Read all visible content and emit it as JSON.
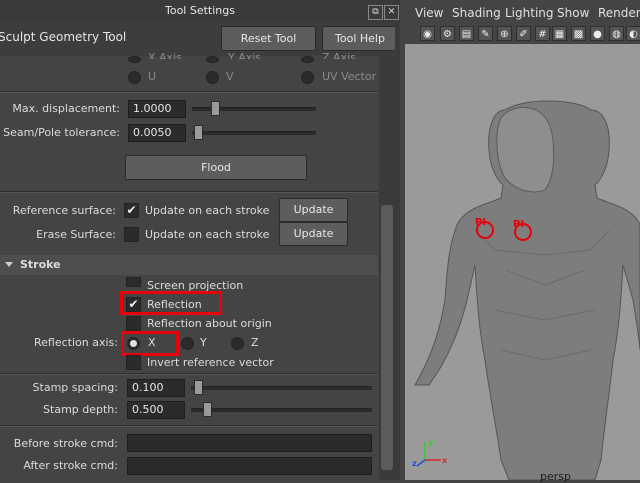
{
  "window": {
    "title": "Tool Settings"
  },
  "header": {
    "tool_name": "Sculpt Geometry Tool",
    "reset_label": "Reset Tool",
    "help_label": "Tool Help"
  },
  "axis_options": {
    "row1": [
      "X Axis",
      "Y Axis",
      "Z Axis"
    ],
    "row2": [
      "U",
      "V",
      "UV Vector"
    ]
  },
  "displacement": {
    "label": "Max. displacement:",
    "value": "1.0000",
    "level": 0.16
  },
  "seam": {
    "label": "Seam/Pole tolerance:",
    "value": "0.0050",
    "level": 0.02
  },
  "flood_label": "Flood",
  "reference_surface": {
    "label": "Reference surface:",
    "checkbox_label": "Update on each stroke",
    "checked": true,
    "button": "Update"
  },
  "erase_surface": {
    "label": "Erase Surface:",
    "checkbox_label": "Update on each stroke",
    "checked": false,
    "button": "Update"
  },
  "stroke": {
    "title": "Stroke",
    "screen_projection": "Screen projection",
    "reflection": "Reflection",
    "reflection_origin": "Reflection about origin",
    "reflection_axis_label": "Reflection axis:",
    "axes": [
      "X",
      "Y",
      "Z"
    ],
    "invert_reference": "Invert reference vector",
    "stamp_spacing": {
      "label": "Stamp spacing:",
      "value": "0.100",
      "level": 0.02
    },
    "stamp_depth": {
      "label": "Stamp depth:",
      "value": "0.500",
      "level": 0.07
    },
    "before_cmd_label": "Before stroke cmd:",
    "after_cmd_label": "After stroke cmd:"
  },
  "viewport": {
    "menus": [
      "View",
      "Shading",
      "Lighting",
      "Show",
      "Renderer"
    ],
    "camera": "persp",
    "axis_labels": {
      "y": "y",
      "z": "z",
      "x": "x"
    },
    "markers": [
      "PI",
      "PI"
    ]
  },
  "colors": {
    "highlight_box": "#e8000b",
    "marker": "#e8000b",
    "panel_bg": "#444444",
    "viewport_bg": "#9a9a9a"
  }
}
